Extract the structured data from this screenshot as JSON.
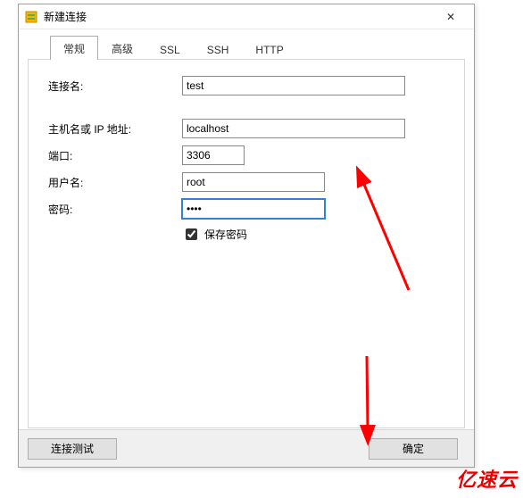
{
  "window": {
    "title": "新建连接",
    "close_glyph": "✕"
  },
  "tabs": {
    "general": "常规",
    "advanced": "高级",
    "ssl": "SSL",
    "ssh": "SSH",
    "http": "HTTP"
  },
  "fields": {
    "conn_name_label": "连接名:",
    "conn_name_value": "test",
    "host_label": "主机名或 IP 地址:",
    "host_value": "localhost",
    "port_label": "端口:",
    "port_value": "3306",
    "user_label": "用户名:",
    "user_value": "root",
    "pass_label": "密码:",
    "pass_value": "••••",
    "save_pass_label": "保存密码"
  },
  "buttons": {
    "test": "连接测试",
    "ok": "确定"
  },
  "watermark": "亿速云",
  "colors": {
    "arrow": "#ff0000"
  }
}
